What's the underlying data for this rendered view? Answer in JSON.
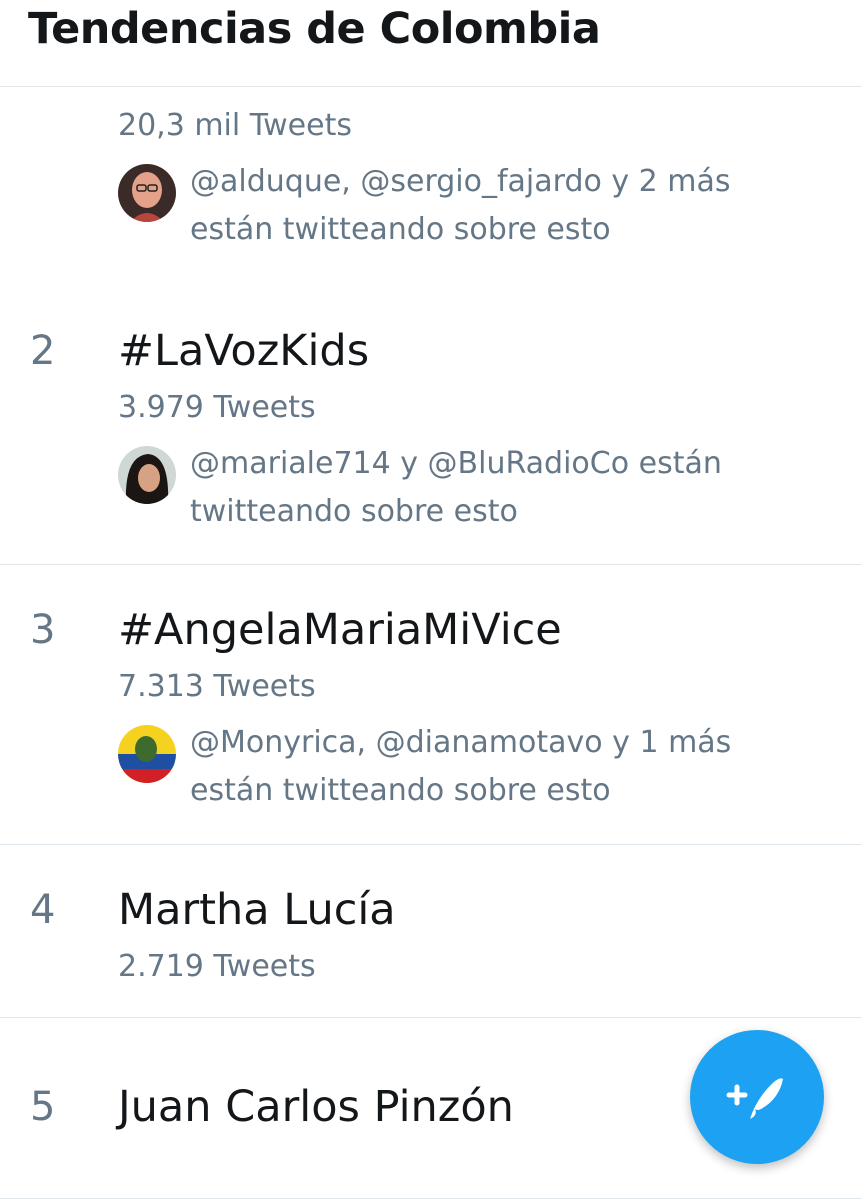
{
  "header": {
    "title": "Tendencias de Colombia"
  },
  "trends": [
    {
      "rank": "",
      "name": "",
      "count": "20,3 mil Tweets",
      "context": "@alduque, @sergio_fajardo y 2 más están twitteando sobre esto"
    },
    {
      "rank": "2",
      "name": "#LaVozKids",
      "count": "3.979 Tweets",
      "context": "@mariale714 y @BluRadioCo están twitteando sobre esto"
    },
    {
      "rank": "3",
      "name": "#AngelaMariaMiVice",
      "count": "7.313 Tweets",
      "context": "@Monyrica, @dianamotavo y 1 más están twitteando sobre esto"
    },
    {
      "rank": "4",
      "name": "Martha Lucía",
      "count": "2.719 Tweets"
    },
    {
      "rank": "5",
      "name": "Juan Carlos Pinzón"
    }
  ],
  "fab": {
    "icon": "compose-tweet-icon"
  },
  "colors": {
    "accent": "#1da1f2",
    "text": "#14171a",
    "secondary": "#657786",
    "divider": "#e1e8ed"
  }
}
